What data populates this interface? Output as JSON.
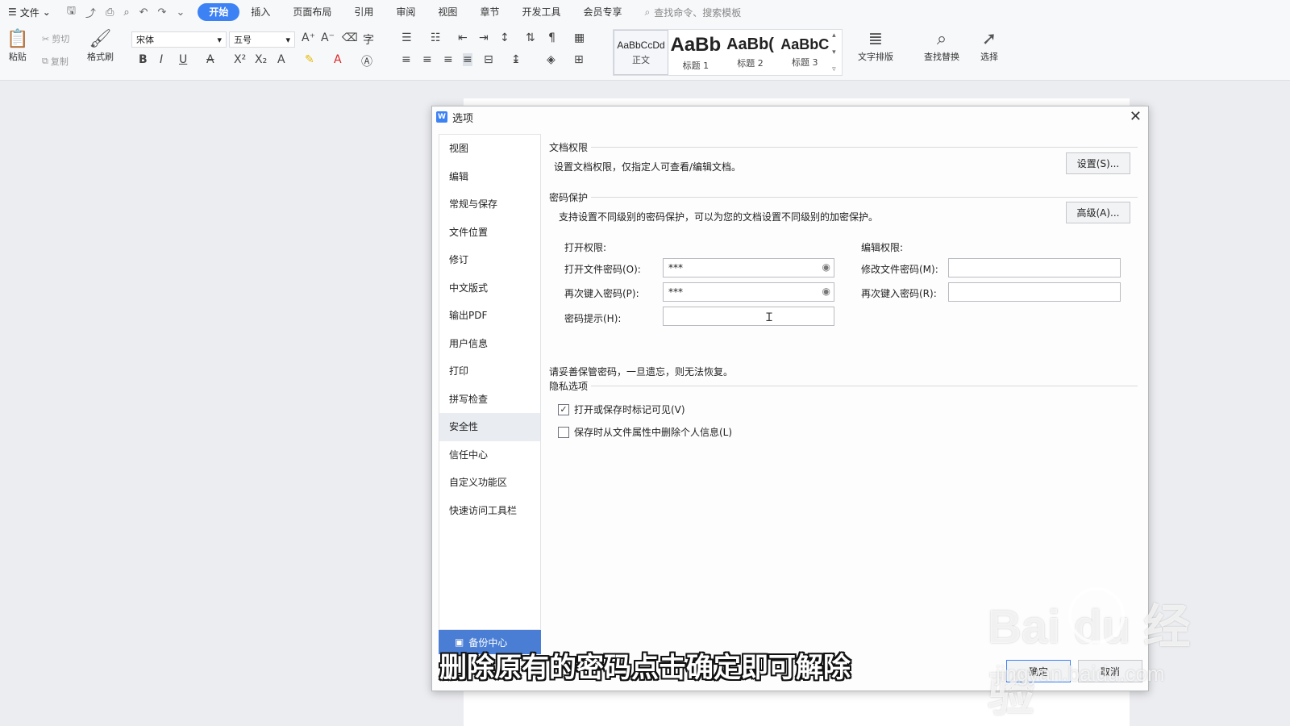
{
  "menubar": {
    "file_label": "文件",
    "tabs": [
      "开始",
      "插入",
      "页面布局",
      "引用",
      "审阅",
      "视图",
      "章节",
      "开发工具",
      "会员专享"
    ],
    "active_tab": "开始",
    "search_placeholder": "查找命令、搜索模板"
  },
  "ribbon": {
    "paste": "粘贴",
    "cut": "剪切",
    "copy": "复制",
    "format_painter": "格式刷",
    "font_name": "宋体",
    "font_size": "五号",
    "styles": [
      {
        "sample": "AaBbCcDd",
        "name": "正文"
      },
      {
        "sample": "AaBb",
        "name": "标题 1"
      },
      {
        "sample": "AaBb(",
        "name": "标题 2"
      },
      {
        "sample": "AaBbC",
        "name": "标题 3"
      }
    ],
    "text_layout": "文字排版",
    "find_replace": "查找替换",
    "select": "选择"
  },
  "dialog": {
    "title": "选项",
    "sidebar": [
      "视图",
      "编辑",
      "常规与保存",
      "文件位置",
      "修订",
      "中文版式",
      "输出PDF",
      "用户信息",
      "打印",
      "拼写检查",
      "安全性",
      "信任中心",
      "自定义功能区",
      "快速访问工具栏"
    ],
    "active_item": "安全性",
    "doc_permission": {
      "heading": "文档权限",
      "desc": "设置文档权限，仅指定人可查看/编辑文档。",
      "button": "设置(S)..."
    },
    "password": {
      "heading": "密码保护",
      "desc": "支持设置不同级别的密码保护，可以为您的文档设置不同级别的加密保护。",
      "advanced_button": "高级(A)...",
      "open_heading": "打开权限:",
      "edit_heading": "编辑权限:",
      "open_pw_label": "打开文件密码(O):",
      "open_pw_value": "***",
      "reenter_open_label": "再次键入密码(P):",
      "reenter_open_value": "***",
      "hint_label": "密码提示(H):",
      "hint_value": "",
      "edit_pw_label": "修改文件密码(M):",
      "edit_pw_value": "",
      "reenter_edit_label": "再次键入密码(R):",
      "reenter_edit_value": "",
      "warning": "请妥善保管密码，一旦遗忘，则无法恢复。"
    },
    "privacy": {
      "heading": "隐私选项",
      "opt1_label": "打开或保存时标记可见(V)",
      "opt1_checked": true,
      "opt2_label": "保存时从文件属性中删除个人信息(L)",
      "opt2_checked": false
    },
    "backup_label": "备份中心",
    "ok": "确定",
    "cancel": "取消"
  },
  "caption": "删除原有的密码点击确定即可解除",
  "watermark": {
    "text": "Bai du 经验",
    "sub": "jingyan.baidu.com"
  }
}
